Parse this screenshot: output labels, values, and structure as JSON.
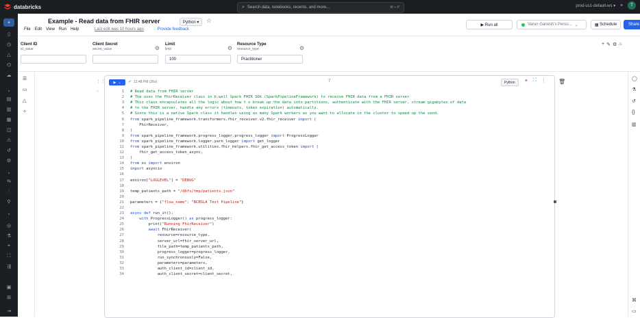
{
  "topbar": {
    "brand": "databricks",
    "search_placeholder": "Search data, notebooks, recents, and more...",
    "search_shortcut": "⌘ + P",
    "workspace": "prod-us1-default-ws ▾",
    "avatar_initial": "T"
  },
  "header": {
    "title": "Example - Read data from FHIR server",
    "language": "Python ▾",
    "menu": [
      "File",
      "Edit",
      "View",
      "Run",
      "Help"
    ],
    "last_edit": "Last edit was 10 hours ago",
    "feedback": "Provide feedback",
    "run_all": "▶  Run all",
    "cluster": "Varun Ganesh's Perso...",
    "schedule": "Schedule",
    "share": "Share"
  },
  "params": [
    {
      "name": "Client ID",
      "key": "id_value",
      "value": ""
    },
    {
      "name": "Client Secret",
      "key": "secret_value",
      "value": ""
    },
    {
      "name": "Limit",
      "key": "limit",
      "value": "100"
    },
    {
      "name": "Resource Type",
      "key": "resource_type",
      "value": "Practitioner"
    }
  ],
  "cell": {
    "run_label": "▶",
    "status_time": "12:48 PM (26s)",
    "cell_number": "7",
    "language": "Python",
    "lines": [
      "# Read data from FHIR server",
      "# The uses the FhirReceiver class in b.well Spark FHIR SDk (SparkPipelineFramework) to receive FHIR data from a FHIR server",
      "# This class encapsulates all the logic about how t o break up the data into partitions, authenticate with the FHIR server, stream gigabytes of data",
      "# to the FHIR server, handle any errors (timeouts, token expiration) automatically.",
      "# Since this is a native Spark class it handles using as many Spark workers as you want to allocate in the cluster to speed up the send.",
      "from spark_pipeline_framework.transformers.fhir_receiver.v2.fhir_receiver import (",
      "    FhirReceiver,",
      ")",
      "from spark_pipeline_framework.progress_logger.progress_logger import ProgressLogger",
      "from spark_pipeline_framework.logger.yarn_logger import get_logger",
      "from spark_pipeline_framework.utilities.fhir_helpers.fhir_get_access_token import (",
      "    fhir_get_access_token_async,",
      ")",
      "from os import environ",
      "import asyncio",
      "",
      "environ[\"LOGLEVEL\"] = \"DEBUG\"",
      "",
      "temp_patients_path = \"/dbfs/tmp/patients.json\"",
      "",
      "parameters = {\"flow_name\": \"BCBSLA Test Pipeline\"}",
      "",
      "async def run_it():",
      "    with ProgressLogger() as progress_logger:",
      "        print(\"Running FhirReceiver\")",
      "        await FhirReceiver(",
      "            resource=resource_type,",
      "            server_url=fhir_server_url,",
      "            file_path=temp_patients_path,",
      "            progress_logger=progress_logger,",
      "            run_synchronously=False,",
      "            parameters=parameters,",
      "            auth_client_id=client_id,",
      "            auth_client_secret=client_secret,"
    ]
  },
  "colors": {
    "accent": "#2563eb",
    "comment": "#15803d",
    "keyword": "#1d4ed8",
    "string": "#b91c1c",
    "chrome": "#1b1f23"
  }
}
